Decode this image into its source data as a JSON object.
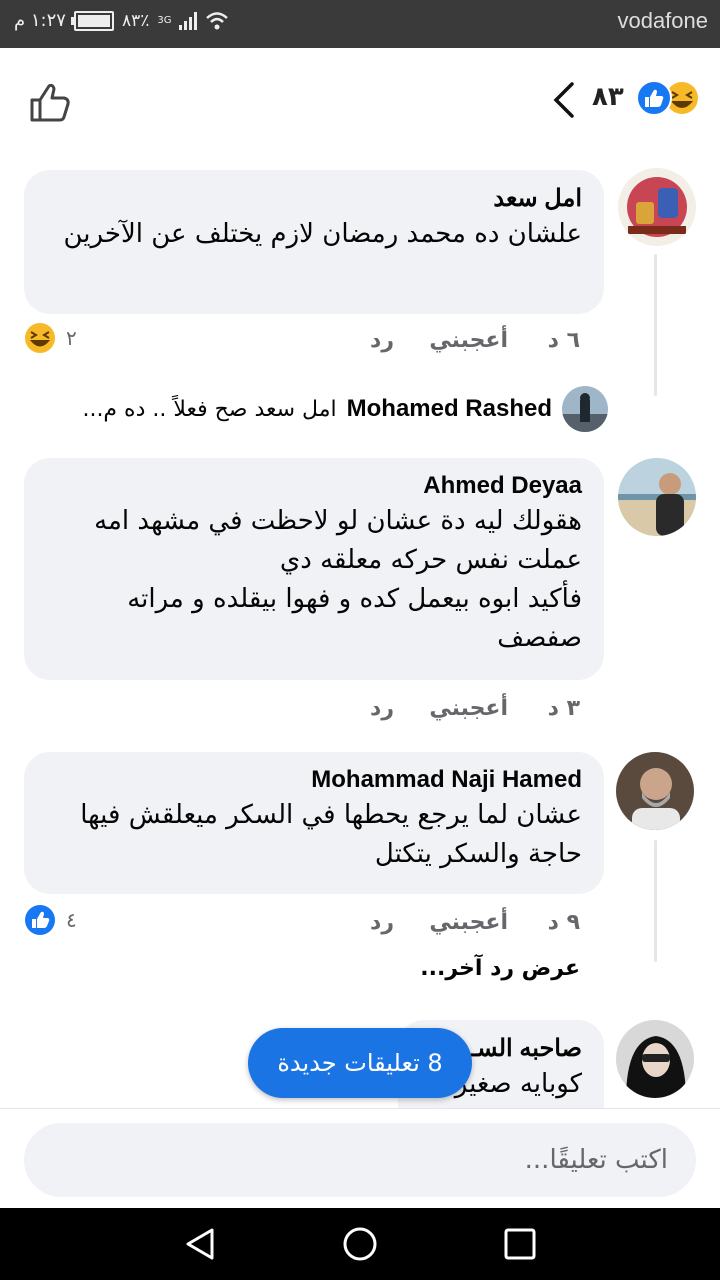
{
  "status_bar": {
    "carrier": "vodafone",
    "time": "١:٢٧ م",
    "battery": "٨٣٪",
    "network": "3G"
  },
  "header": {
    "reaction_count": "٨٣",
    "reaction_icons": [
      "haha-icon",
      "like-icon"
    ]
  },
  "comments": [
    {
      "author": "امل سعد",
      "text": "علشان ده محمد رمضان لازم يختلف عن الآخرين",
      "time": "٦ د",
      "like_label": "أعجبني",
      "reply_label": "رد",
      "reaction_count": "٢",
      "reaction_icon": "haha-icon"
    },
    {
      "author": "Ahmed Deyaa",
      "text": "هقولك ليه دة عشان لو لاحظت في مشهد امه عملت نفس حركه معلقه دي\nفأكيد ابوه بيعمل كده و فهوا بيقلده و مراته صفصف",
      "time": "٣ د",
      "like_label": "أعجبني",
      "reply_label": "رد"
    },
    {
      "author": "Mohammad Naji Hamed",
      "text": "عشان لما يرجع يحطها في السكر ميعلقش فيها حاجة والسكر يتكتل",
      "time": "٩ د",
      "like_label": "أعجبني",
      "reply_label": "رد",
      "reaction_count": "٤",
      "reaction_icon": "like-icon"
    },
    {
      "author": "صاحبه السـ",
      "text": "كوبايه صغيرة"
    }
  ],
  "reply_preview": {
    "author": "Mohamed Rashed",
    "text": "امل سعد صح فعلاً .. ده م..."
  },
  "view_more_replies": "عرض رد آخر...",
  "new_comments_pill": "8 تعليقات جديدة",
  "composer": {
    "placeholder": "اكتب تعليقًا..."
  },
  "colors": {
    "accent": "#1b74e4",
    "bubble": "#f0f2f5",
    "muted_text": "#65676b"
  }
}
